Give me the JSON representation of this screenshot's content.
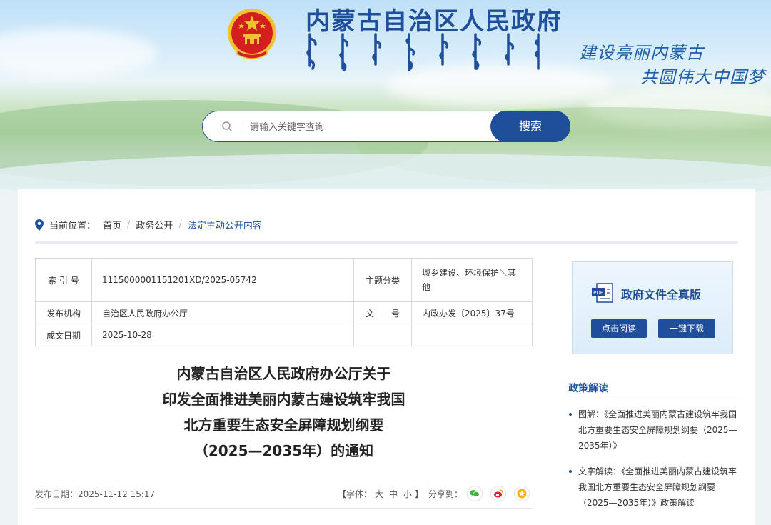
{
  "header": {
    "site_title": "内蒙古自治区人民政府",
    "slogan_line1": "建设亮丽内蒙古",
    "slogan_line2": "共圆伟大中国梦"
  },
  "search": {
    "placeholder": "请输入关键字查询",
    "button_label": "搜索"
  },
  "breadcrumb": {
    "prefix": "当前位置：",
    "items": [
      "首页",
      "政务公开",
      "法定主动公开内容"
    ]
  },
  "meta_table": {
    "index_label": "索 引 号",
    "index_value": "1115000001151201XD/2025-05742",
    "topic_label": "主题分类",
    "topic_value": "城乡建设、环境保护＼其他",
    "publisher_label": "发布机构",
    "publisher_value": "自治区人民政府办公厅",
    "docno_label": "文　　号",
    "docno_value": "内政办发〔2025〕37号",
    "date_label": "成文日期",
    "date_value": "2025-10-28"
  },
  "article": {
    "title_lines": [
      "内蒙古自治区人民政府办公厅关于",
      "印发全面推进美丽内蒙古建设筑牢我国",
      "北方重要生态安全屏障规划纲要",
      "（2025—2035年）的通知"
    ],
    "publish_date": "发布日期：2025-11-12 15:17",
    "font_prefix": "【字体：",
    "font_large": "大",
    "font_medium": "中",
    "font_small": "小",
    "font_suffix": "】",
    "share_label": "分享到："
  },
  "side": {
    "pdf_title": "政府文件全真版",
    "read_button": "点击阅读",
    "download_button": "一键下载",
    "policy_heading": "政策解读",
    "policy_items": [
      "图解：《全面推进美丽内蒙古建设筑牢我国北方重要生态安全屏障规划纲要（2025—2035年）》",
      "文字解读：《全面推进美丽内蒙古建设筑牢我国北方重要生态安全屏障规划纲要（2025—2035年）》政策解读"
    ]
  },
  "colors": {
    "brand": "#1f4f9a",
    "emblem_red": "#d3201f",
    "emblem_gold": "#f2c230"
  },
  "icons": [
    "national-emblem-icon",
    "search-icon",
    "location-pin-icon",
    "pdf-icon",
    "wechat-icon",
    "weibo-icon",
    "favorite-icon"
  ]
}
